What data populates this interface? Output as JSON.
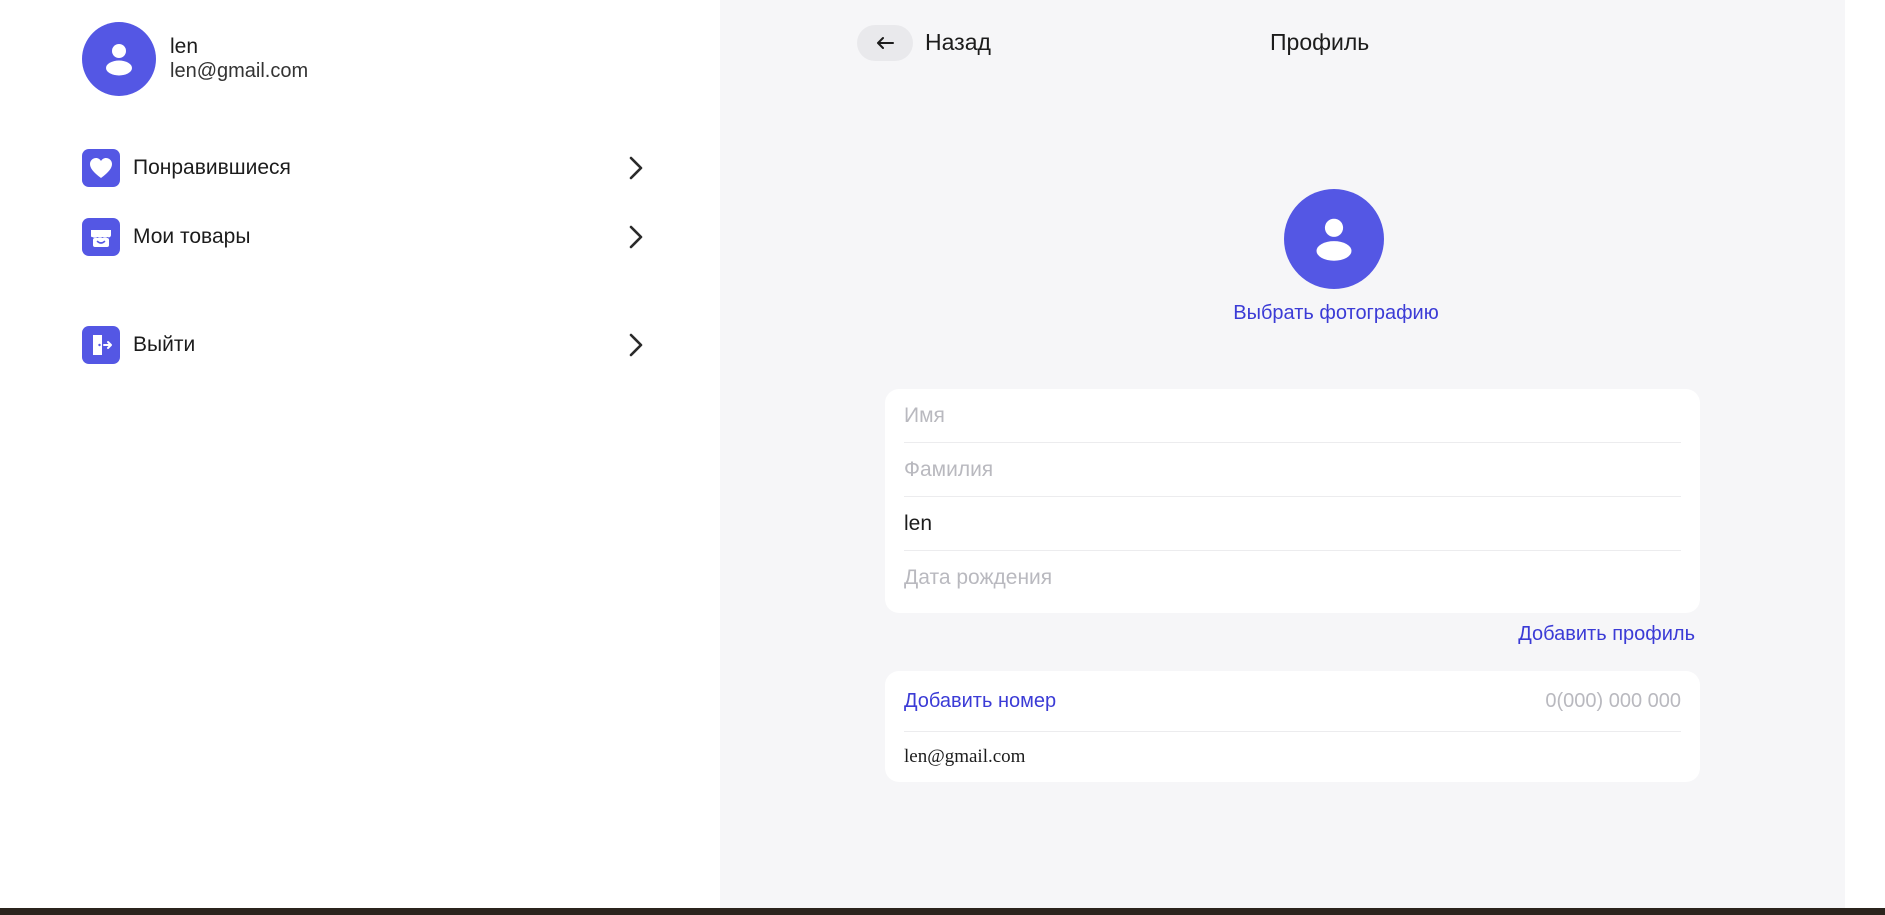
{
  "user": {
    "name": "len",
    "email": "len@gmail.com"
  },
  "sidebar": {
    "items": [
      {
        "label": "Понравившиеся",
        "icon": "heart-icon"
      },
      {
        "label": "Мои товары",
        "icon": "store-icon"
      },
      {
        "label": "Выйти",
        "icon": "logout-icon"
      }
    ]
  },
  "header": {
    "back_label": "Назад",
    "title": "Профиль"
  },
  "profile": {
    "choose_photo": "Выбрать фотографию",
    "fields": {
      "first_name": {
        "placeholder": "Имя",
        "value": ""
      },
      "last_name": {
        "placeholder": "Фамилия",
        "value": ""
      },
      "username": {
        "placeholder": "",
        "value": "len"
      },
      "birth_date": {
        "placeholder": "Дата рождения",
        "value": ""
      }
    },
    "add_profile": "Добавить профиль"
  },
  "contacts": {
    "add_number": "Добавить номер",
    "phone_placeholder": "0(000) 000 000",
    "email": "len@gmail.com"
  },
  "colors": {
    "accent": "#5457e4",
    "link": "#3b3bd6",
    "panel_bg": "#f6f6f8",
    "placeholder": "#b9b9bf"
  }
}
